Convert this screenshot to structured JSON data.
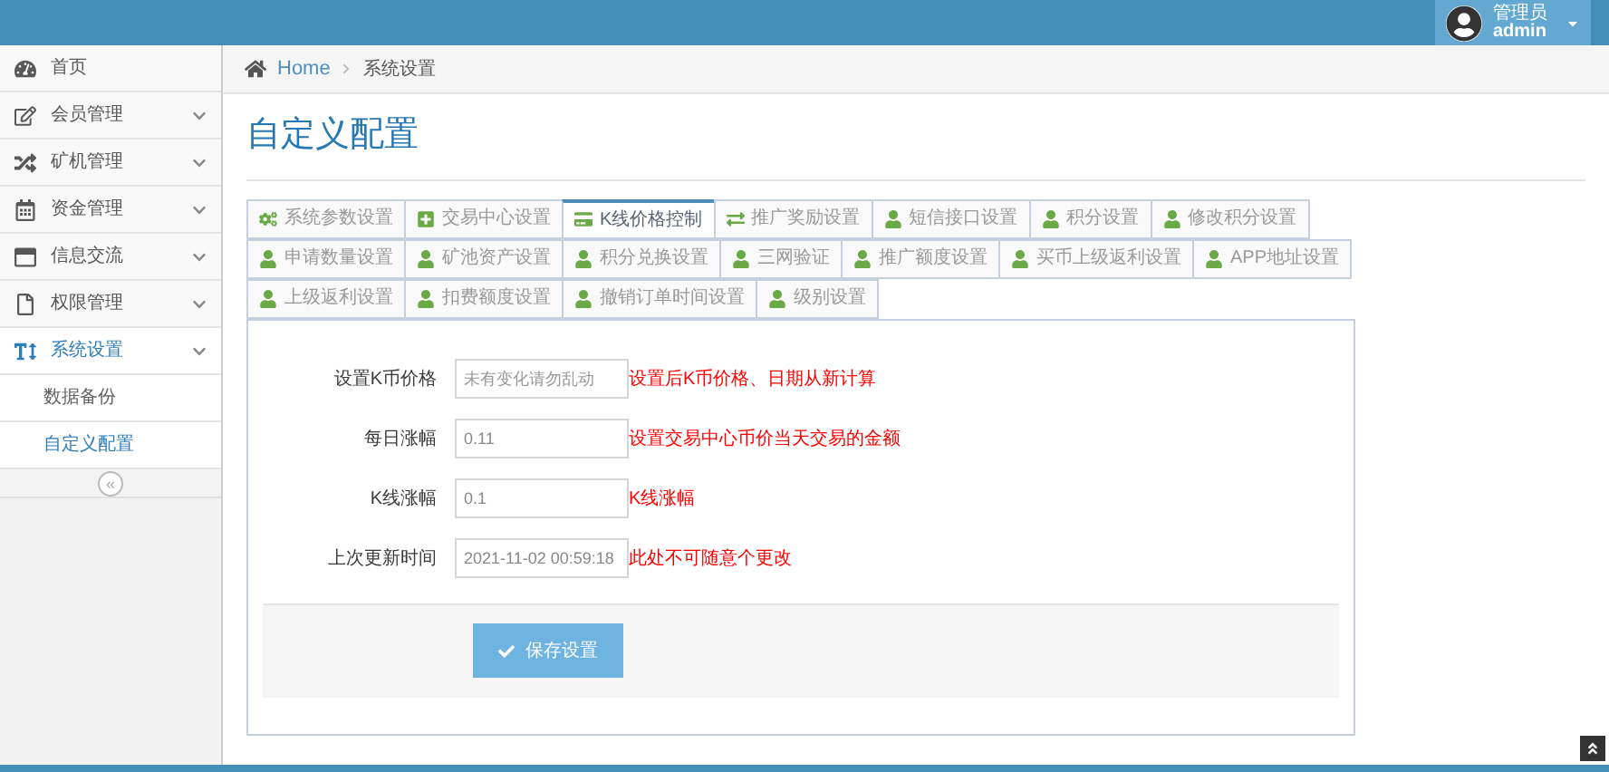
{
  "user": {
    "role": "管理员",
    "name": "admin"
  },
  "sidebar": {
    "items": [
      {
        "label": "首页",
        "kind": "dashboard",
        "selected": false
      },
      {
        "label": "会员管理",
        "kind": "edit",
        "selected": false
      },
      {
        "label": "矿机管理",
        "kind": "shuffle",
        "selected": false
      },
      {
        "label": "资金管理",
        "kind": "calendar",
        "selected": false
      },
      {
        "label": "信息交流",
        "kind": "window",
        "selected": false
      },
      {
        "label": "权限管理",
        "kind": "file",
        "selected": false
      },
      {
        "label": "系统设置",
        "kind": "text",
        "selected": true,
        "children": [
          {
            "label": "数据备份",
            "selected": false
          },
          {
            "label": "自定义配置",
            "selected": true
          }
        ]
      }
    ],
    "collapse": "«"
  },
  "breadcrumb": [
    "Home",
    "系统设置"
  ],
  "page_title": "自定义配置",
  "tabs": [
    {
      "label": "系统参数设置",
      "kind": "cogs",
      "selected": false
    },
    {
      "label": "交易中心设置",
      "kind": "plus",
      "selected": false
    },
    {
      "label": "K线价格控制",
      "kind": "card",
      "selected": true
    },
    {
      "label": "推广奖励设置",
      "kind": "exchange",
      "selected": false
    },
    {
      "label": "短信接口设置",
      "kind": "user",
      "selected": false
    },
    {
      "label": "积分设置",
      "kind": "user",
      "selected": false
    },
    {
      "label": "修改积分设置",
      "kind": "user",
      "selected": false
    },
    {
      "label": "申请数量设置",
      "kind": "user",
      "selected": false
    },
    {
      "label": "矿池资产设置",
      "kind": "user",
      "selected": false
    },
    {
      "label": "积分兑换设置",
      "kind": "user",
      "selected": false
    },
    {
      "label": "三网验证",
      "kind": "user",
      "selected": false
    },
    {
      "label": "推广额度设置",
      "kind": "user",
      "selected": false
    },
    {
      "label": "买币上级返利设置",
      "kind": "user",
      "selected": false
    },
    {
      "label": "APP地址设置",
      "kind": "user",
      "selected": false
    },
    {
      "label": "上级返利设置",
      "kind": "user",
      "selected": false
    },
    {
      "label": "扣费额度设置",
      "kind": "user",
      "selected": false
    },
    {
      "label": "撤销订单时间设置",
      "kind": "user",
      "selected": false
    },
    {
      "label": "级别设置",
      "kind": "user",
      "selected": false
    }
  ],
  "form": {
    "fields": [
      {
        "label": "设置K币价格",
        "placeholder": "未有变化请勿乱动",
        "hint": "设置后K币价格、日期从新计算"
      },
      {
        "label": "每日涨幅",
        "value": "0.11",
        "hint": "设置交易中心币价当天交易的金额"
      },
      {
        "label": "K线涨幅",
        "value": "0.1",
        "hint": "K线涨幅"
      },
      {
        "label": "上次更新时间",
        "value": "2021-11-02 00:59:18",
        "hint": "此处不可随意个更改"
      }
    ],
    "submit": "保存设置"
  }
}
